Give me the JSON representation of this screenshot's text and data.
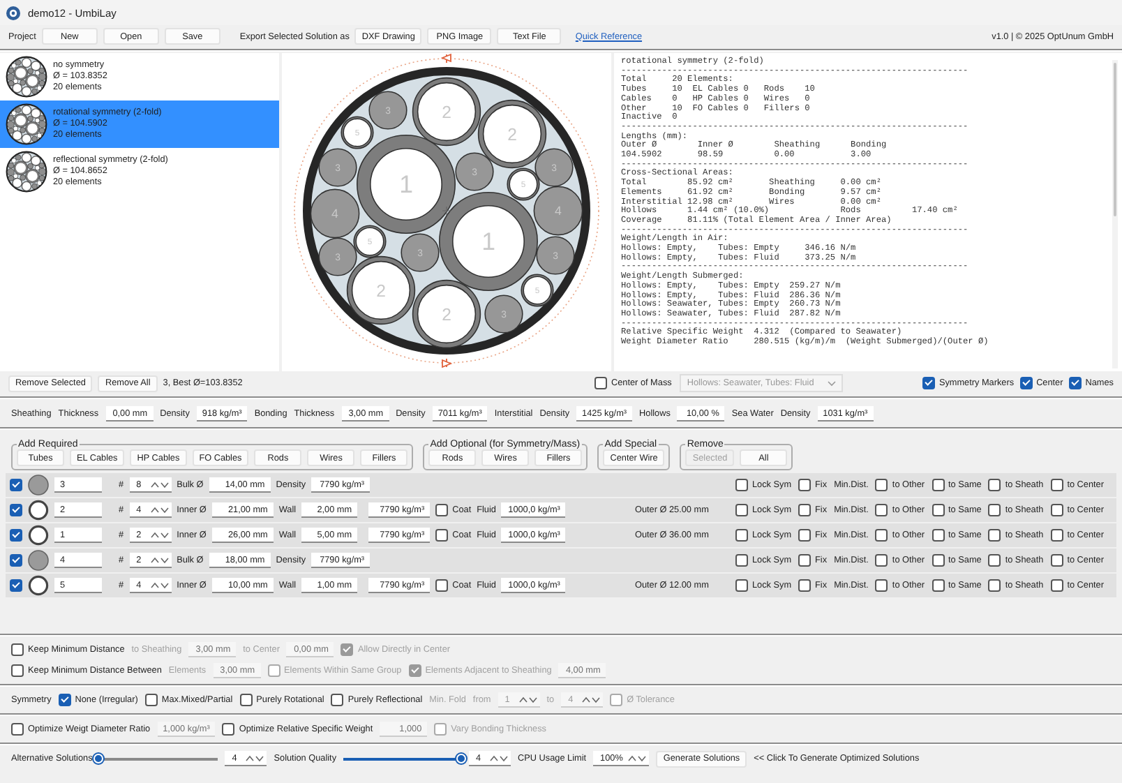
{
  "window": {
    "title": "demo12 - UmbiLay"
  },
  "toolbar": {
    "project_label": "Project",
    "project_buttons": [
      "New",
      "Open",
      "Save"
    ],
    "export_label": "Export Selected Solution as",
    "export_buttons": [
      "DXF Drawing",
      "PNG Image",
      "Text File"
    ],
    "link": "Quick Reference",
    "version": "v1.0 | © 2025 OptUnum GmbH"
  },
  "solutions": [
    {
      "name": "no symmetry",
      "diameter": "Ø = 103.8352",
      "elements": "20 elements",
      "selected": false
    },
    {
      "name": "rotational symmetry (2-fold)",
      "diameter": "Ø = 104.5902",
      "elements": "20 elements",
      "selected": true
    },
    {
      "name": "reflectional symmetry (2-fold)",
      "diameter": "Ø = 104.8652",
      "elements": "20 elements",
      "selected": false
    }
  ],
  "cross_section": {
    "elements": [
      {
        "label": "1",
        "kind": "tube"
      },
      {
        "label": "1",
        "kind": "tube"
      },
      {
        "label": "2",
        "kind": "tube"
      },
      {
        "label": "2",
        "kind": "tube"
      },
      {
        "label": "2",
        "kind": "tube"
      },
      {
        "label": "2",
        "kind": "tube"
      },
      {
        "label": "3",
        "kind": "rod"
      },
      {
        "label": "3",
        "kind": "rod"
      },
      {
        "label": "3",
        "kind": "rod"
      },
      {
        "label": "3",
        "kind": "rod"
      },
      {
        "label": "3",
        "kind": "rod"
      },
      {
        "label": "3",
        "kind": "rod"
      },
      {
        "label": "3",
        "kind": "rod"
      },
      {
        "label": "3",
        "kind": "rod"
      },
      {
        "label": "4",
        "kind": "rod"
      },
      {
        "label": "4",
        "kind": "rod"
      },
      {
        "label": "5",
        "kind": "tube"
      },
      {
        "label": "5",
        "kind": "tube"
      },
      {
        "label": "5",
        "kind": "tube"
      },
      {
        "label": "5",
        "kind": "tube"
      }
    ]
  },
  "report": {
    "lines": [
      "rotational symmetry (2-fold)",
      "--------------------------------------------------------------------",
      "Total     20 Elements:",
      "Tubes     10  EL Cables 0   Rods    10",
      "Cables    0   HP Cables 0   Wires   0",
      "Other     10  FO Cables 0   Fillers 0",
      "Inactive  0",
      "--------------------------------------------------------------------",
      "Lengths (mm):",
      "Outer Ø        Inner Ø        Sheathing      Bonding",
      "104.5902       98.59          0.00           3.00",
      "--------------------------------------------------------------------",
      "Cross-Sectional Areas:",
      "Total        85.92 cm²       Sheathing     0.00 cm²",
      "Elements     61.92 cm²       Bonding       9.57 cm²",
      "Interstitial 12.98 cm²       Wires         0.00 cm²",
      "Hollows      1.44 cm² (10.0%)              Rods          17.40 cm²",
      "Coverage     81.11% (Total Element Area / Inner Area)",
      "--------------------------------------------------------------------",
      "Weight/Length in Air:",
      "Hollows: Empty,    Tubes: Empty     346.16 N/m",
      "Hollows: Empty,    Tubes: Fluid     373.25 N/m",
      "--------------------------------------------------------------------",
      "Weight/Length Submerged:",
      "Hollows: Empty,    Tubes: Empty  259.27 N/m",
      "Hollows: Empty,    Tubes: Fluid  286.36 N/m",
      "Hollows: Seawater, Tubes: Empty  260.73 N/m",
      "Hollows: Seawater, Tubes: Fluid  287.82 N/m",
      "--------------------------------------------------------------------",
      "Relative Specific Weight  4.312  (Compared to Seawater)",
      "Weight Diameter Ratio     280.515 (kg/m)/m  (Weight Submerged)/(Outer Ø)"
    ]
  },
  "control_bar": {
    "left": [
      {
        "kind": "button",
        "label": "Remove Selected",
        "disabled": false
      },
      {
        "kind": "button",
        "label": "Remove All",
        "disabled": false
      },
      {
        "kind": "text",
        "label": "3, Best Ø=103.8352"
      }
    ],
    "middle": [
      {
        "kind": "checkbox",
        "label": "Center of Mass",
        "checked": false,
        "disabled": false
      },
      {
        "kind": "select",
        "value": "Hollows: Seawater, Tubes: Fluid",
        "disabled": true
      }
    ],
    "right": [
      {
        "kind": "checkbox",
        "label": "Symmetry Markers",
        "checked": true,
        "disabled": false
      },
      {
        "kind": "checkbox",
        "label": "Center",
        "checked": true,
        "disabled": false
      },
      {
        "kind": "checkbox",
        "label": "Names",
        "checked": true,
        "disabled": false
      }
    ]
  },
  "materials": [
    {
      "kind": "label",
      "label": "Sheathing",
      "disabled": false
    },
    {
      "kind": "label",
      "label": "Thickness",
      "disabled": false
    },
    {
      "kind": "field",
      "value": "0,00 mm",
      "disabled": false
    },
    {
      "kind": "label",
      "label": "Density",
      "disabled": false
    },
    {
      "kind": "field",
      "value": "918 kg/m³",
      "disabled": false
    },
    {
      "kind": "label",
      "label": "Bonding",
      "disabled": false
    },
    {
      "kind": "label",
      "label": "Thickness",
      "disabled": false
    },
    {
      "kind": "field",
      "value": "3,00 mm",
      "disabled": false
    },
    {
      "kind": "label",
      "label": "Density",
      "disabled": false
    },
    {
      "kind": "field",
      "value": "7011 kg/m³",
      "disabled": false
    },
    {
      "kind": "label",
      "label": "Interstitial",
      "disabled": false
    },
    {
      "kind": "label",
      "label": "Density",
      "disabled": false
    },
    {
      "kind": "field",
      "value": "1425 kg/m³",
      "disabled": false
    },
    {
      "kind": "label",
      "label": "Hollows",
      "disabled": false
    },
    {
      "kind": "field",
      "value": "10,00 %",
      "disabled": false
    },
    {
      "kind": "label",
      "label": "Sea Water",
      "disabled": false
    },
    {
      "kind": "label",
      "label": "Density",
      "disabled": false
    },
    {
      "kind": "field",
      "value": "1031 kg/m³",
      "disabled": false
    }
  ],
  "add_groups": [
    {
      "title": "Add Required",
      "buttons": [
        {
          "label": "Tubes",
          "disabled": false
        },
        {
          "label": "EL Cables",
          "disabled": false
        },
        {
          "label": "HP Cables",
          "disabled": false
        },
        {
          "label": "FO Cables",
          "disabled": false
        },
        {
          "label": "Rods",
          "disabled": false
        },
        {
          "label": "Wires",
          "disabled": false
        },
        {
          "label": "Fillers",
          "disabled": false
        }
      ]
    },
    {
      "title": "Add Optional (for Symmetry/Mass)",
      "buttons": [
        {
          "label": "Rods",
          "disabled": false
        },
        {
          "label": "Wires",
          "disabled": false
        },
        {
          "label": "Fillers",
          "disabled": false
        }
      ]
    },
    {
      "title": "Add Special",
      "buttons": [
        {
          "label": "Center Wire",
          "disabled": false
        }
      ]
    },
    {
      "title": "Remove",
      "buttons": [
        {
          "label": "Selected",
          "disabled": true
        },
        {
          "label": "All",
          "disabled": false
        }
      ]
    }
  ],
  "element_rows": [
    {
      "kind": "rod",
      "enabled": true,
      "name": "3",
      "count_label": "#",
      "count": "8",
      "diameter_label": "Bulk Ø",
      "diameter": "14,00 mm",
      "density_label": "Density",
      "density": "7790 kg/m³",
      "checks": [
        {
          "label": "Lock Sym",
          "checked": false
        },
        {
          "label": "Fix",
          "checked": false
        }
      ],
      "min_dist_label": "Min.Dist.",
      "min_dist": [
        {
          "label": "to Other",
          "checked": false
        },
        {
          "label": "to Same",
          "checked": false
        },
        {
          "label": "to Sheath",
          "checked": false
        },
        {
          "label": "to Center",
          "checked": false
        }
      ]
    },
    {
      "kind": "tube",
      "enabled": true,
      "name": "2",
      "count_label": "#",
      "count": "4",
      "diameter_label": "Inner Ø",
      "diameter": "21,00 mm",
      "wall_label": "Wall",
      "wall": "2,00 mm",
      "density": "7790 kg/m³",
      "coat": {
        "label": "Coat",
        "checked": false
      },
      "fluid_label": "Fluid",
      "fluid": "1000,0 kg/m³",
      "outer": "Outer Ø 25.00 mm",
      "checks": [
        {
          "label": "Lock Sym",
          "checked": false
        },
        {
          "label": "Fix",
          "checked": false
        }
      ],
      "min_dist_label": "Min.Dist.",
      "min_dist": [
        {
          "label": "to Other",
          "checked": false
        },
        {
          "label": "to Same",
          "checked": false
        },
        {
          "label": "to Sheath",
          "checked": false
        },
        {
          "label": "to Center",
          "checked": false
        }
      ]
    },
    {
      "kind": "tube",
      "enabled": true,
      "name": "1",
      "count_label": "#",
      "count": "2",
      "diameter_label": "Inner Ø",
      "diameter": "26,00 mm",
      "wall_label": "Wall",
      "wall": "5,00 mm",
      "density": "7790 kg/m³",
      "coat": {
        "label": "Coat",
        "checked": false
      },
      "fluid_label": "Fluid",
      "fluid": "1000,0 kg/m³",
      "outer": "Outer Ø 36.00 mm",
      "checks": [
        {
          "label": "Lock Sym",
          "checked": false
        },
        {
          "label": "Fix",
          "checked": false
        }
      ],
      "min_dist_label": "Min.Dist.",
      "min_dist": [
        {
          "label": "to Other",
          "checked": false
        },
        {
          "label": "to Same",
          "checked": false
        },
        {
          "label": "to Sheath",
          "checked": false
        },
        {
          "label": "to Center",
          "checked": false
        }
      ]
    },
    {
      "kind": "rod",
      "enabled": true,
      "name": "4",
      "count_label": "#",
      "count": "2",
      "diameter_label": "Bulk Ø",
      "diameter": "18,00 mm",
      "density_label": "Density",
      "density": "7790 kg/m³",
      "checks": [
        {
          "label": "Lock Sym",
          "checked": false
        },
        {
          "label": "Fix",
          "checked": false
        }
      ],
      "min_dist_label": "Min.Dist.",
      "min_dist": [
        {
          "label": "to Other",
          "checked": false
        },
        {
          "label": "to Same",
          "checked": false
        },
        {
          "label": "to Sheath",
          "checked": false
        },
        {
          "label": "to Center",
          "checked": false
        }
      ]
    },
    {
      "kind": "tube",
      "enabled": true,
      "name": "5",
      "count_label": "#",
      "count": "4",
      "diameter_label": "Inner Ø",
      "diameter": "10,00 mm",
      "wall_label": "Wall",
      "wall": "1,00 mm",
      "density": "7790 kg/m³",
      "coat": {
        "label": "Coat",
        "checked": false
      },
      "fluid_label": "Fluid",
      "fluid": "1000,0 kg/m³",
      "outer": "Outer Ø 12.00 mm",
      "checks": [
        {
          "label": "Lock Sym",
          "checked": false
        },
        {
          "label": "Fix",
          "checked": false
        }
      ],
      "min_dist_label": "Min.Dist.",
      "min_dist": [
        {
          "label": "to Other",
          "checked": false
        },
        {
          "label": "to Same",
          "checked": false
        },
        {
          "label": "to Sheath",
          "checked": false
        },
        {
          "label": "to Center",
          "checked": false
        }
      ]
    }
  ],
  "sections": [
    {
      "rows": [
        {
          "items": [
            {
              "kind": "checkbox",
              "label": "Keep Minimum Distance",
              "checked": false,
              "disabled": false
            },
            {
              "kind": "label",
              "label": "to Sheathing",
              "disabled": true
            },
            {
              "kind": "field",
              "value": "3,00 mm",
              "disabled": true
            },
            {
              "kind": "label",
              "label": "to Center",
              "disabled": true
            },
            {
              "kind": "field",
              "value": "0,00 mm",
              "disabled": true
            },
            {
              "kind": "checkbox",
              "label": "Allow Directly in Center",
              "checked": true,
              "disabled": true
            }
          ]
        },
        {
          "items": [
            {
              "kind": "checkbox",
              "label": "Keep Minimum Distance Between",
              "checked": false,
              "disabled": false
            },
            {
              "kind": "label",
              "label": "Elements",
              "disabled": true
            },
            {
              "kind": "field",
              "value": "3,00 mm",
              "disabled": true
            },
            {
              "kind": "checkbox",
              "label": "Elements Within Same Group",
              "checked": false,
              "disabled": true
            },
            {
              "kind": "checkbox",
              "label": "Elements Adjacent to Sheathing",
              "checked": true,
              "disabled": true
            },
            {
              "kind": "field",
              "value": "4,00 mm",
              "disabled": true
            }
          ]
        }
      ]
    },
    {
      "rows": [
        {
          "items": [
            {
              "kind": "label",
              "label": "Symmetry",
              "disabled": false
            },
            {
              "kind": "checkbox",
              "label": "None (Irregular)",
              "checked": true,
              "disabled": false
            },
            {
              "kind": "checkbox",
              "label": "Max.Mixed/Partial",
              "checked": false,
              "disabled": false
            },
            {
              "kind": "checkbox",
              "label": "Purely Rotational",
              "checked": false,
              "disabled": false
            },
            {
              "kind": "checkbox",
              "label": "Purely Reflectional",
              "checked": false,
              "disabled": false
            },
            {
              "kind": "label",
              "label": "Min. Fold",
              "disabled": true
            },
            {
              "kind": "label",
              "label": "from",
              "disabled": true
            },
            {
              "kind": "spinner",
              "value": "1",
              "disabled": true
            },
            {
              "kind": "label",
              "label": "to",
              "disabled": true
            },
            {
              "kind": "spinner",
              "value": "4",
              "disabled": true
            },
            {
              "kind": "checkbox",
              "label": "Ø Tolerance",
              "checked": false,
              "disabled": true
            }
          ]
        }
      ]
    },
    {
      "rows": [
        {
          "items": [
            {
              "kind": "checkbox",
              "label": "Optimize Weigt Diameter Ratio",
              "checked": false,
              "disabled": false
            },
            {
              "kind": "field",
              "value": "1,000 kg/m³",
              "disabled": true
            },
            {
              "kind": "checkbox",
              "label": "Optimize Relative Specific Weight",
              "checked": false,
              "disabled": false
            },
            {
              "kind": "field",
              "value": "1,000",
              "disabled": true
            },
            {
              "kind": "checkbox",
              "label": "Vary Bonding Thickness",
              "checked": false,
              "disabled": true
            }
          ]
        }
      ]
    },
    {
      "rows": [
        {
          "items": [
            {
              "kind": "label",
              "label": "Alternative Solutions",
              "disabled": false
            },
            {
              "kind": "slider",
              "level": 0
            },
            {
              "kind": "spinner",
              "value": "4",
              "disabled": false
            },
            {
              "kind": "label",
              "label": "Solution Quality",
              "disabled": false
            },
            {
              "kind": "slider",
              "level": 1
            },
            {
              "kind": "spinner",
              "value": "4",
              "disabled": false
            },
            {
              "kind": "label",
              "label": "CPU Usage Limit",
              "disabled": false
            },
            {
              "kind": "spinner",
              "value": "100%",
              "disabled": false
            },
            {
              "kind": "button",
              "label": "Generate Solutions",
              "disabled": false
            },
            {
              "kind": "label",
              "label": "<< Click To Generate Optimized Solutions",
              "disabled": false
            }
          ]
        }
      ]
    }
  ]
}
